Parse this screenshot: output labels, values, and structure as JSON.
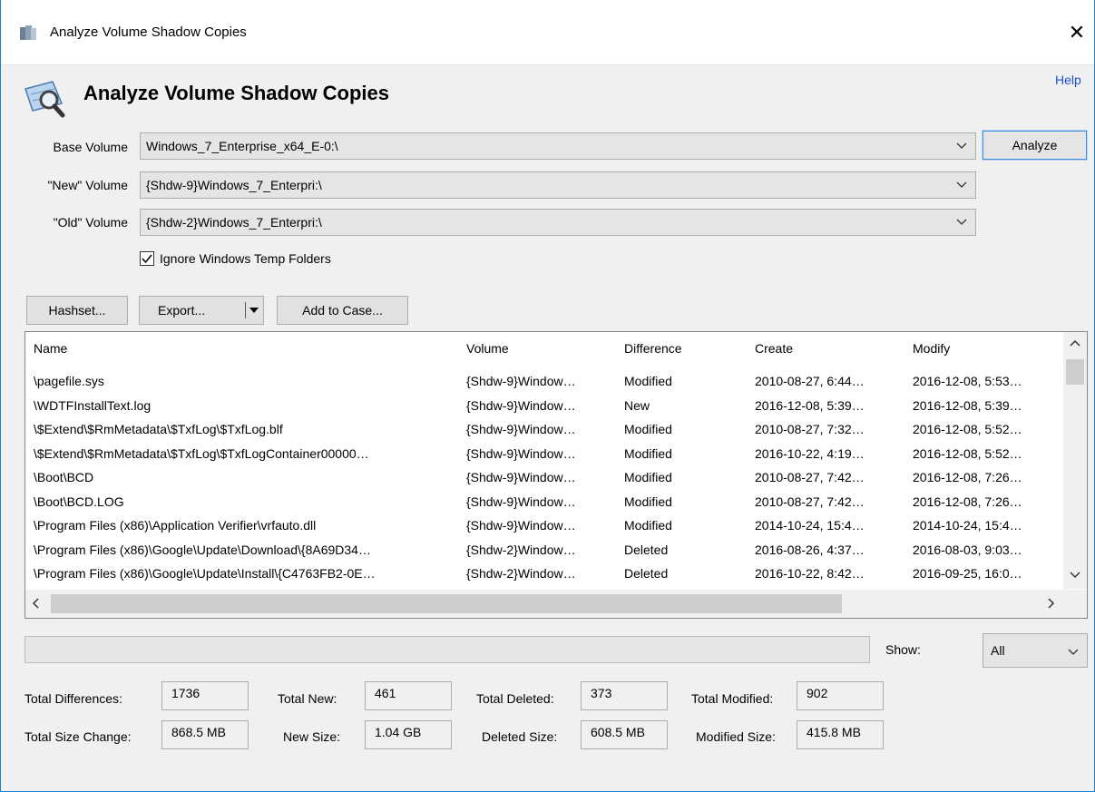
{
  "window": {
    "title": "Analyze Volume Shadow Copies",
    "close": "✕"
  },
  "header": {
    "heading": "Analyze Volume Shadow Copies",
    "help": "Help"
  },
  "fields": {
    "base_label": "Base Volume",
    "base_value": "Windows_7_Enterprise_x64_E-0:\\",
    "new_label": "\"New\" Volume",
    "new_value": "{Shdw-9}Windows_7_Enterpri:\\",
    "old_label": "\"Old\" Volume",
    "old_value": "{Shdw-2}Windows_7_Enterpri:\\",
    "analyze": "Analyze",
    "ignore_temp_label": "Ignore Windows Temp Folders",
    "ignore_temp_checked": true
  },
  "toolbar": {
    "hashset": "Hashset...",
    "export": "Export...",
    "add_to_case": "Add to Case..."
  },
  "table": {
    "columns": [
      "Name",
      "Volume",
      "Difference",
      "Create",
      "Modify"
    ],
    "rows": [
      [
        "\\pagefile.sys",
        "{Shdw-9}Window…",
        "Modified",
        "2010-08-27, 6:44…",
        "2016-12-08, 5:53…"
      ],
      [
        "\\WDTFInstallText.log",
        "{Shdw-9}Window…",
        "New",
        "2016-12-08, 5:39…",
        "2016-12-08, 5:39…"
      ],
      [
        "\\$Extend\\$RmMetadata\\$TxfLog\\$TxfLog.blf",
        "{Shdw-9}Window…",
        "Modified",
        "2010-08-27, 7:32…",
        "2016-12-08, 5:52…"
      ],
      [
        "\\$Extend\\$RmMetadata\\$TxfLog\\$TxfLogContainer00000…",
        "{Shdw-9}Window…",
        "Modified",
        "2016-10-22, 4:19…",
        "2016-12-08, 5:52…"
      ],
      [
        "\\Boot\\BCD",
        "{Shdw-9}Window…",
        "Modified",
        "2010-08-27, 7:42…",
        "2016-12-08, 7:26…"
      ],
      [
        "\\Boot\\BCD.LOG",
        "{Shdw-9}Window…",
        "Modified",
        "2010-08-27, 7:42…",
        "2016-12-08, 7:26…"
      ],
      [
        "\\Program Files (x86)\\Application Verifier\\vrfauto.dll",
        "{Shdw-9}Window…",
        "Modified",
        "2014-10-24, 15:4…",
        "2014-10-24, 15:4…"
      ],
      [
        "\\Program Files (x86)\\Google\\Update\\Download\\{8A69D34…",
        "{Shdw-2}Window…",
        "Deleted",
        "2016-08-26, 4:37…",
        "2016-08-03, 9:03…"
      ],
      [
        "\\Program Files (x86)\\Google\\Update\\Install\\{C4763FB2-0E…",
        "{Shdw-2}Window…",
        "Deleted",
        "2016-10-22, 8:42…",
        "2016-09-25, 16:0…"
      ]
    ]
  },
  "filter": {
    "show_label": "Show:",
    "show_value": "All"
  },
  "stats": {
    "total_diff_label": "Total Differences:",
    "total_diff": "1736",
    "total_new_label": "Total New:",
    "total_new": "461",
    "total_deleted_label": "Total Deleted:",
    "total_deleted": "373",
    "total_modified_label": "Total Modified:",
    "total_modified": "902",
    "total_size_label": "Total Size Change:",
    "total_size": "868.5 MB",
    "new_size_label": "New Size:",
    "new_size": "1.04 GB",
    "deleted_size_label": "Deleted Size:",
    "deleted_size": "608.5 MB",
    "modified_size_label": "Modified Size:",
    "modified_size": "415.8 MB"
  }
}
